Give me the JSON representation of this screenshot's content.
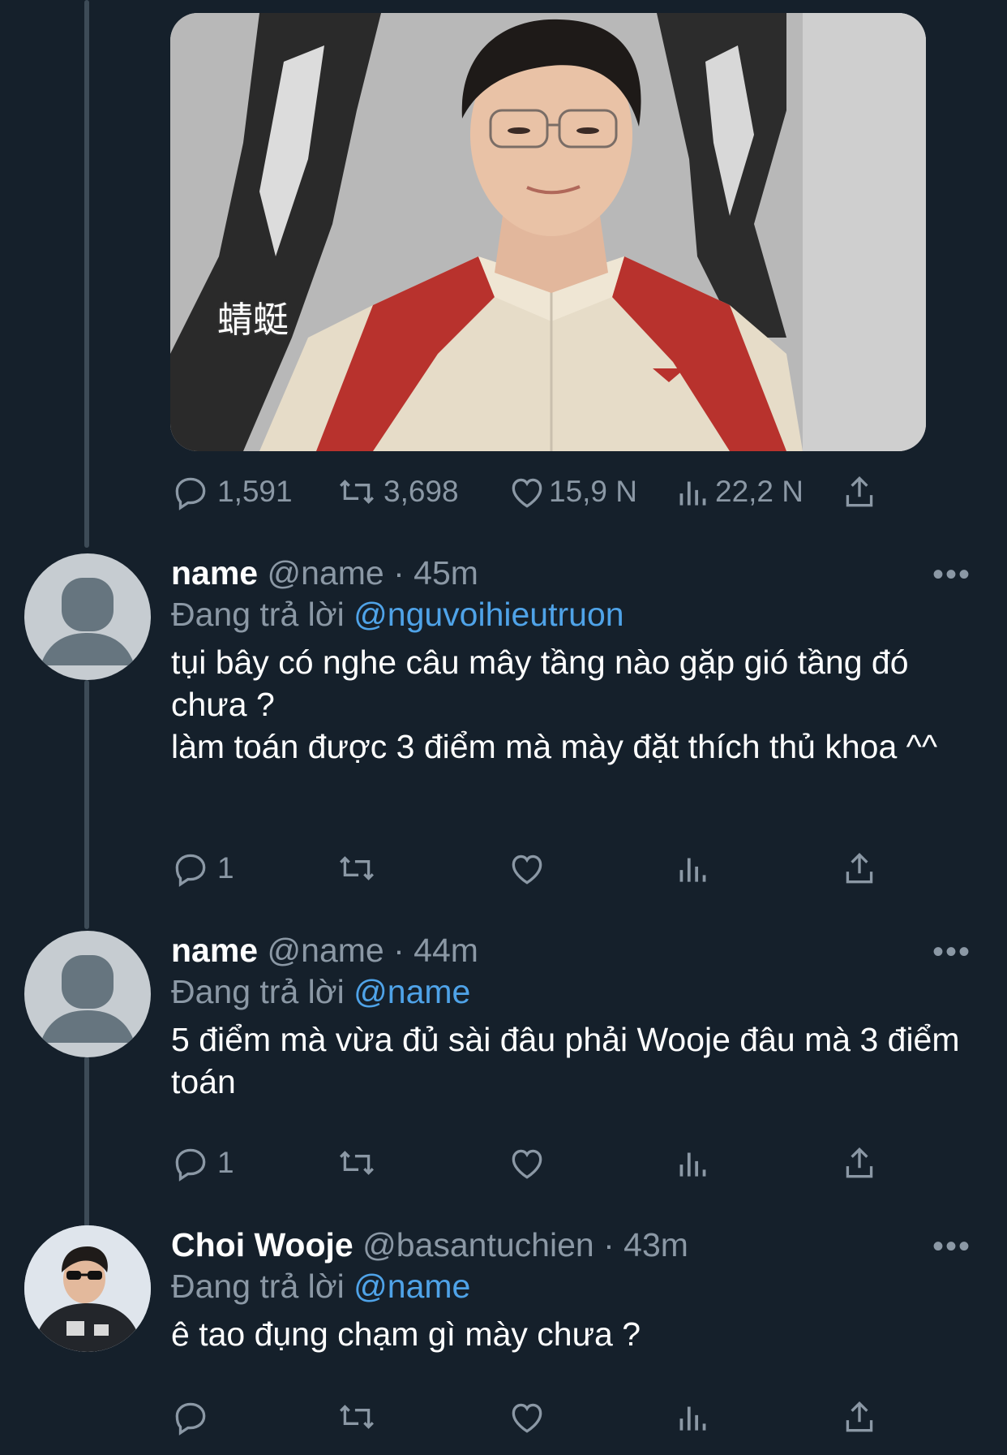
{
  "main_tweet": {
    "media": {
      "caption": "蜻蜓"
    },
    "actions": {
      "replies": "1,591",
      "retweets": "3,698",
      "likes": "15,9 N",
      "views": "22,2 N"
    }
  },
  "replies": [
    {
      "display_name": "name",
      "handle": "@name",
      "separator": "·",
      "time": "45m",
      "replying_prefix": "Đang trả lời",
      "replying_to": "@nguvoihieutruon",
      "text": "tụi bây có nghe câu mây tầng nào gặp gió tầng đó chưa ?\nlàm toán được 3 điểm mà mày đặt thích thủ khoa ^^",
      "reply_count": "1",
      "more": "•••"
    },
    {
      "display_name": "name",
      "handle": "@name",
      "separator": "·",
      "time": "44m",
      "replying_prefix": "Đang trả lời",
      "replying_to": "@name",
      "text": "5 điểm mà vừa đủ sài đâu phải Wooje đâu mà 3 điểm toán",
      "reply_count": "1",
      "more": "•••"
    },
    {
      "display_name": "Choi Wooje",
      "handle": "@basantuchien",
      "separator": "·",
      "time": "43m",
      "replying_prefix": "Đang trả lời",
      "replying_to": "@name",
      "text": "ê tao đụng chạm gì mày chưa ?",
      "reply_count": "",
      "more": "•••"
    }
  ],
  "colors": {
    "background": "#15202b",
    "secondary_text": "#8b98a5",
    "link": "#4fa3e8",
    "thread_line": "#3d4b57"
  }
}
